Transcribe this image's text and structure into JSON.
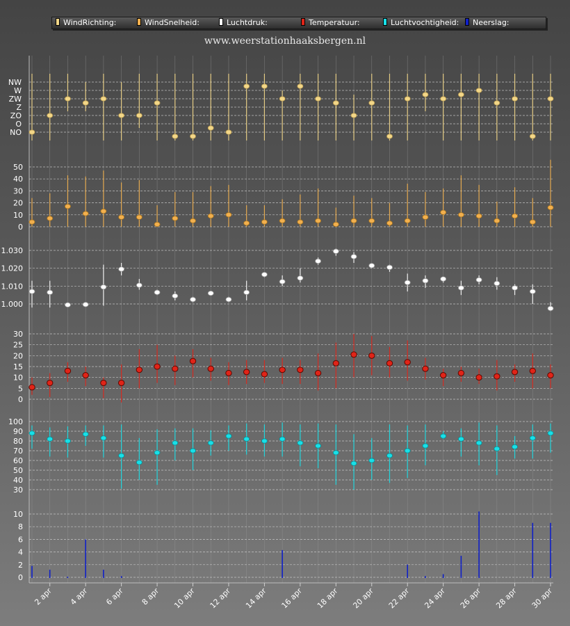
{
  "site": "www.weerstationhaaksbergen.nl",
  "legend": [
    {
      "label": "WindRichting:",
      "color": "#f3d788"
    },
    {
      "label": "WindSnelheid:",
      "color": "#f2b04e"
    },
    {
      "label": "Luchtdruk:",
      "color": "#ffffff"
    },
    {
      "label": "Temperatuur:",
      "color": "#e02418"
    },
    {
      "label": "Luchtvochtigheid:",
      "color": "#18e0e8"
    },
    {
      "label": "Neerslag:",
      "color": "#1020c8"
    }
  ],
  "chart_data": {
    "type": "multi-panel",
    "x": [
      "1 apr",
      "2 apr",
      "3 apr",
      "4 apr",
      "5 apr",
      "6 apr",
      "7 apr",
      "8 apr",
      "9 apr",
      "10 apr",
      "11 apr",
      "12 apr",
      "13 apr",
      "14 apr",
      "15 apr",
      "16 apr",
      "17 apr",
      "18 apr",
      "19 apr",
      "20 apr",
      "21 apr",
      "22 apr",
      "23 apr",
      "24 apr",
      "25 apr",
      "26 apr",
      "27 apr",
      "28 apr",
      "29 apr",
      "30 apr"
    ],
    "x_tick_labels": [
      "2 apr",
      "4 apr",
      "6 apr",
      "8 apr",
      "10 apr",
      "12 apr",
      "14 apr",
      "16 apr",
      "18 apr",
      "20 apr",
      "22 apr",
      "24 apr",
      "26 apr",
      "28 apr",
      "30 apr"
    ],
    "panels": [
      {
        "name": "WindRichting",
        "categories": [
          "NO",
          "O",
          "ZO",
          "Z",
          "ZW",
          "W",
          "NW"
        ],
        "values": [
          0,
          2,
          4,
          3.5,
          4,
          2,
          2,
          3.5,
          -0.5,
          -0.5,
          0.5,
          0,
          5.5,
          5.5,
          4,
          5.5,
          4,
          3.5,
          2,
          3.5,
          -0.5,
          4,
          4.5,
          4,
          4.5,
          5,
          3.5,
          4,
          -0.5,
          4
        ],
        "range_min": [
          -1,
          -1,
          2.5,
          2.5,
          -1,
          -1,
          0.5,
          -1,
          -1,
          -1,
          -1,
          -1,
          -1,
          -1,
          -1,
          -1,
          -1,
          -1,
          -1,
          -1,
          -1,
          -1,
          2.5,
          -1,
          -1,
          -1,
          -1,
          -1,
          -1,
          -1
        ],
        "range_max": [
          7,
          7,
          7,
          6,
          7,
          6,
          7,
          7,
          7,
          7,
          7,
          7,
          7,
          7,
          5,
          7,
          7,
          7,
          4.5,
          7,
          7,
          7,
          7,
          7,
          7,
          7,
          7,
          7,
          7,
          7
        ],
        "color": "#f3d788"
      },
      {
        "name": "WindSnelheid",
        "ticks": [
          0,
          10,
          20,
          30,
          40,
          50
        ],
        "values": [
          4,
          7,
          17,
          11,
          13,
          8,
          8,
          2,
          7,
          5,
          9,
          10,
          3,
          4,
          5,
          4,
          5,
          2,
          5,
          5,
          3,
          5,
          8,
          12,
          10,
          9,
          5,
          9,
          4,
          16
        ],
        "range_min": [
          0,
          0,
          0,
          0,
          0,
          0,
          0,
          0,
          0,
          0,
          0,
          0,
          0,
          0,
          0,
          0,
          0,
          0,
          0,
          0,
          0,
          0,
          0,
          0,
          0,
          0,
          0,
          0,
          0,
          0
        ],
        "range_max": [
          24,
          28,
          43,
          42,
          47,
          37,
          39,
          18,
          29,
          29,
          34,
          35,
          18,
          18,
          23,
          27,
          32,
          16,
          26,
          24,
          20,
          36,
          29,
          32,
          43,
          35,
          21,
          33,
          24,
          56
        ],
        "color": "#f2b04e"
      },
      {
        "name": "Luchtdruk",
        "ticks": [
          1.0,
          1.01,
          1.02,
          1.03
        ],
        "tick_labels": [
          "1.000",
          "1.010",
          "1.020",
          "1.030"
        ],
        "values": [
          1.007,
          1.0065,
          0.9995,
          0.9997,
          1.0095,
          1.0195,
          1.0105,
          1.0065,
          1.0045,
          1.0025,
          1.006,
          1.0025,
          1.0065,
          1.0165,
          1.0125,
          1.0145,
          1.024,
          1.0295,
          1.0265,
          1.0215,
          1.0205,
          1.012,
          1.013,
          1.014,
          1.009,
          1.0135,
          1.0115,
          1.009,
          1.007,
          0.9975
        ],
        "range_min": [
          0.998,
          0.998,
          0.999,
          0.999,
          0.999,
          1.016,
          1.008,
          1.005,
          1.002,
          1.001,
          1.005,
          1.001,
          1.002,
          1.015,
          1.01,
          1.012,
          1.022,
          1.027,
          1.023,
          1.02,
          1.018,
          1.007,
          1.009,
          1.012,
          1.005,
          1.011,
          1.008,
          1.005,
          1.0,
          0.996
        ],
        "range_max": [
          1.013,
          1.013,
          1.0,
          1.001,
          1.022,
          1.023,
          1.014,
          1.008,
          1.007,
          1.004,
          1.007,
          1.004,
          1.013,
          1.017,
          1.016,
          1.02,
          1.026,
          1.031,
          1.029,
          1.022,
          1.022,
          1.017,
          1.016,
          1.015,
          1.013,
          1.016,
          1.015,
          1.011,
          1.011,
          1.001
        ],
        "color": "#ffffff"
      },
      {
        "name": "Temperatuur",
        "ticks": [
          0,
          5,
          10,
          15,
          20,
          25,
          30
        ],
        "values": [
          5.5,
          7.5,
          13,
          11,
          7.5,
          7.5,
          13.5,
          15,
          14,
          17.5,
          14,
          12,
          12.5,
          11.5,
          13.5,
          13.5,
          12,
          16.5,
          20.5,
          20,
          16.5,
          17,
          14,
          11,
          12,
          10,
          10.5,
          12.5,
          13,
          11
        ],
        "range_min": [
          2,
          1,
          8,
          6,
          0.5,
          -1.5,
          5,
          7.5,
          6.5,
          10,
          8.5,
          6.5,
          7,
          7.5,
          7,
          7,
          4,
          5,
          10,
          11,
          10,
          8.5,
          9,
          6,
          8,
          7,
          4,
          8,
          5,
          5
        ],
        "range_max": [
          10,
          12,
          17,
          15,
          10,
          16,
          23,
          25,
          20,
          23,
          19,
          17,
          18,
          18,
          19,
          18,
          21,
          26,
          30,
          29,
          24,
          27,
          19,
          14,
          15,
          14,
          18,
          16,
          21,
          16
        ],
        "color": "#e02418"
      },
      {
        "name": "Luchtvochtigheid",
        "ticks": [
          30,
          40,
          50,
          60,
          70,
          80,
          90,
          100
        ],
        "values": [
          88,
          82,
          80,
          87,
          83,
          65,
          58,
          68,
          78,
          70,
          78,
          85,
          82,
          80,
          82,
          78,
          75,
          68,
          57,
          60,
          65,
          70,
          75,
          85,
          82,
          78,
          72,
          74,
          83,
          88
        ],
        "range_min": [
          72,
          64,
          63,
          75,
          63,
          31,
          40,
          35,
          60,
          50,
          65,
          70,
          66,
          64,
          64,
          54,
          52,
          35,
          30,
          40,
          37,
          42,
          55,
          82,
          64,
          55,
          45,
          62,
          62,
          68
        ],
        "range_max": [
          96,
          94,
          95,
          96,
          96,
          97,
          83,
          92,
          93,
          93,
          91,
          96,
          98,
          97,
          99,
          97,
          98,
          97,
          87,
          83,
          97,
          96,
          97,
          90,
          93,
          99,
          96,
          85,
          97,
          98
        ],
        "color": "#18e0e8"
      },
      {
        "name": "Neerslag",
        "ticks": [
          0,
          2,
          4,
          6,
          8,
          10
        ],
        "values": [
          1.8,
          1.2,
          0.1,
          6.0,
          1.2,
          0.2,
          0,
          0,
          0,
          0,
          0,
          0,
          0,
          0,
          4.3,
          0,
          0,
          0,
          0,
          0,
          0,
          2.0,
          0.2,
          0.5,
          3.4,
          10.4,
          0,
          0,
          8.6,
          8.6
        ],
        "color": "#1020c8"
      }
    ]
  }
}
